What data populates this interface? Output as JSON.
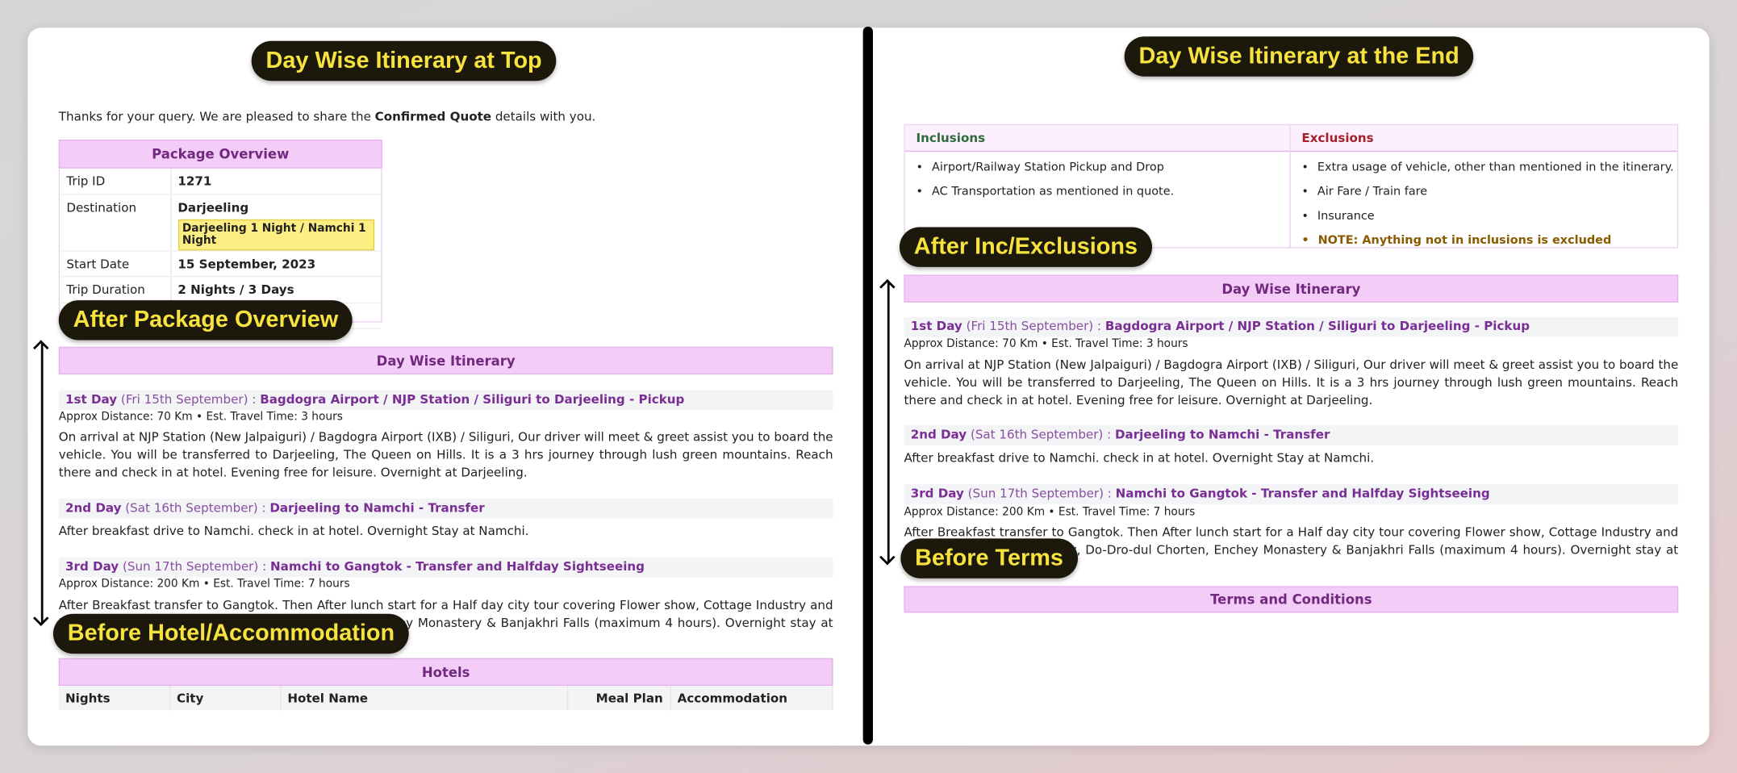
{
  "annotations": {
    "top": "Day Wise Itinerary at Top",
    "end": "Day Wise Itinerary at the End",
    "after_package": "After Package Overview",
    "before_hotel": "Before Hotel/Accommodation",
    "after_inc": "After Inc/Exclusions",
    "before_terms": "Before Terms"
  },
  "intro": {
    "pre": "Thanks for your query. We are pleased to share the ",
    "bold": "Confirmed Quote",
    "post": " details with you."
  },
  "package": {
    "title": "Package Overview",
    "rows": [
      {
        "label": "Trip ID",
        "value": "1271"
      },
      {
        "label": "Destination",
        "value": "Darjeeling",
        "tag": "Darjeeling 1 Night / Namchi 1 Night"
      },
      {
        "label": "Start Date",
        "value": "15 September, 2023"
      },
      {
        "label": "Trip Duration",
        "value": "2 Nights / 3 Days"
      }
    ]
  },
  "itinerary": {
    "title": "Day Wise Itinerary",
    "days": [
      {
        "day": "1st Day",
        "date": "(Fri 15th September)",
        "sep": " : ",
        "title": "Bagdogra Airport / NJP Station / Siliguri to Darjeeling - Pickup",
        "meta": "Approx Distance: 70 Km • Est. Travel Time: 3 hours",
        "text": "On arrival at NJP Station (New Jalpaiguri) / Bagdogra Airport (IXB) / Siliguri, Our driver will meet & greet assist you to board the vehicle. You will be transferred to Darjeeling, The Queen on Hills. It is a 3 hrs journey through lush green mountains. Reach there and check in at hotel. Evening free for leisure. Overnight at Darjeeling."
      },
      {
        "day": "2nd Day",
        "date": "(Sat 16th September)",
        "sep": " : ",
        "title": "Darjeeling to Namchi - Transfer",
        "meta": "",
        "text": "After breakfast drive to Namchi. check in at hotel. Overnight Stay at Namchi."
      },
      {
        "day": "3rd Day",
        "date": "(Sun 17th September)",
        "sep": " : ",
        "title": "Namchi to Gangtok - Transfer and Halfday Sightseeing",
        "meta": "Approx Distance: 200 Km • Est. Travel Time: 7 hours",
        "text": "After Breakfast transfer to Gangtok. Then After lunch start for a Half day city tour covering Flower show, Cottage Industry and Handicraft Centre, Ropeway, Do-Dro-dul Chorten, Enchey Monastery & Banjakhri Falls (maximum 4 hours). Overnight stay at Gangtok."
      }
    ]
  },
  "hotels": {
    "title": "Hotels",
    "columns": [
      "Nights",
      "City",
      "Hotel Name",
      "Meal Plan",
      "Accommodation"
    ]
  },
  "inclusions": {
    "title": "Inclusions",
    "items": [
      "Airport/Railway Station Pickup and Drop",
      "AC Transportation as mentioned in quote."
    ]
  },
  "exclusions": {
    "title": "Exclusions",
    "items": [
      "Extra usage of vehicle, other than mentioned in the itinerary.",
      "Air Fare / Train fare",
      "Insurance"
    ],
    "note": "NOTE: Anything not in inclusions is excluded"
  },
  "terms": {
    "title": "Terms and Conditions"
  },
  "colors": {
    "header_bg": "#f3cdf8",
    "header_text": "#73287f",
    "day_title": "#7a2d95",
    "badge_bg": "#1c180c",
    "badge_text": "#f6e33f",
    "inclusions": "#2e6b3a",
    "exclusions": "#a3202a",
    "note": "#8a5a00"
  }
}
